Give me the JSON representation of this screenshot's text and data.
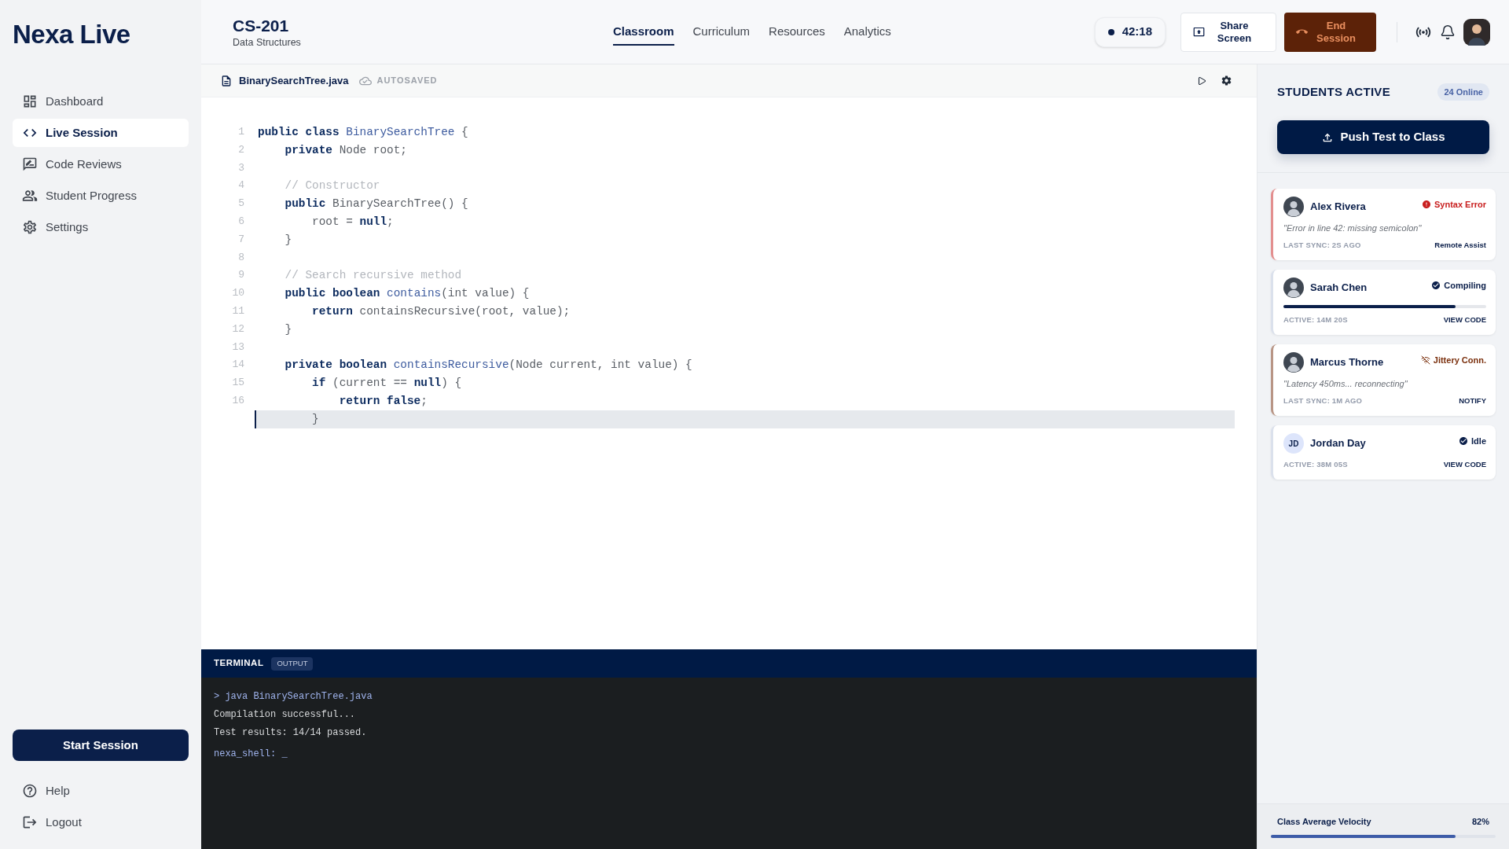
{
  "sidebar": {
    "logo": "Nexa Live",
    "nav": [
      {
        "label": "Dashboard",
        "selected": false
      },
      {
        "label": "Live Session",
        "selected": true
      },
      {
        "label": "Code Reviews",
        "selected": false
      },
      {
        "label": "Student Progress",
        "selected": false
      },
      {
        "label": "Settings",
        "selected": false
      }
    ],
    "start_button": "Start Session",
    "footer_links": [
      "Help",
      "Logout"
    ]
  },
  "header": {
    "course_code": "CS-201",
    "course_name": "Data Structures",
    "tabs": [
      {
        "label": "Classroom",
        "selected": true
      },
      {
        "label": "Curriculum",
        "selected": false
      },
      {
        "label": "Resources",
        "selected": false
      },
      {
        "label": "Analytics",
        "selected": false
      }
    ],
    "timer": "42:18",
    "share_button": "Share Screen",
    "end_button": "End Session"
  },
  "editor": {
    "file_name": "BinarySearchTree.java",
    "save_status": "AUTOSAVED",
    "lines": [
      {
        "number": "1",
        "current": false,
        "tokens": [
          {
            "kind": "kw",
            "text": "public class "
          },
          {
            "kind": "fn",
            "text": "BinarySearchTree"
          },
          {
            "kind": "tx",
            "text": " {"
          }
        ]
      },
      {
        "number": "2",
        "current": false,
        "tokens": [
          {
            "kind": "kw",
            "text": "    private "
          },
          {
            "kind": "tx",
            "text": "Node root;"
          }
        ]
      },
      {
        "number": "3",
        "current": false
      },
      {
        "number": "4",
        "current": false,
        "tokens": [
          {
            "kind": "cm",
            "text": "    // Constructor"
          }
        ]
      },
      {
        "number": "5",
        "current": false,
        "tokens": [
          {
            "kind": "kw",
            "text": "    public "
          },
          {
            "kind": "tx",
            "text": "BinarySearchTree() {"
          }
        ]
      },
      {
        "number": "6",
        "current": false,
        "tokens": [
          {
            "kind": "tx",
            "text": "        root = "
          },
          {
            "kind": "kw",
            "text": "null"
          },
          {
            "kind": "tx",
            "text": ";"
          }
        ]
      },
      {
        "number": "7",
        "current": false,
        "tokens": [
          {
            "kind": "tx",
            "text": "    }"
          }
        ]
      },
      {
        "number": "8",
        "current": false
      },
      {
        "number": "9",
        "current": false,
        "tokens": [
          {
            "kind": "cm",
            "text": "    // Search recursive method"
          }
        ]
      },
      {
        "number": "10",
        "current": false,
        "tokens": [
          {
            "kind": "kw",
            "text": "    public boolean "
          },
          {
            "kind": "fn",
            "text": "contains"
          },
          {
            "kind": "tx",
            "text": "(int value) {"
          }
        ]
      },
      {
        "number": "11",
        "current": false,
        "tokens": [
          {
            "kind": "kw",
            "text": "        return "
          },
          {
            "kind": "tx",
            "text": "containsRecursive(root, value);"
          }
        ]
      },
      {
        "number": "12",
        "current": false,
        "tokens": [
          {
            "kind": "tx",
            "text": "    }"
          }
        ]
      },
      {
        "number": "13",
        "current": false
      },
      {
        "number": "14",
        "current": false,
        "tokens": [
          {
            "kind": "kw",
            "text": "    private boolean "
          },
          {
            "kind": "fn",
            "text": "containsRecursive"
          },
          {
            "kind": "tx",
            "text": "(Node current, int value) {"
          }
        ]
      },
      {
        "number": "15",
        "current": false,
        "tokens": [
          {
            "kind": "kw",
            "text": "        if "
          },
          {
            "kind": "tx",
            "text": "(current == "
          },
          {
            "kind": "kw",
            "text": "null"
          },
          {
            "kind": "tx",
            "text": ") {"
          }
        ]
      },
      {
        "number": "16",
        "current": false,
        "tokens": [
          {
            "kind": "kw",
            "text": "            return false"
          },
          {
            "kind": "tx",
            "text": ";"
          }
        ]
      },
      {
        "current": true,
        "tokens": [
          {
            "kind": "tx",
            "text": "        }"
          }
        ]
      }
    ]
  },
  "terminal": {
    "tabs": [
      {
        "label": "TERMINAL",
        "selected": true
      },
      {
        "label": "OUTPUT",
        "selected": false
      }
    ],
    "lines": [
      {
        "kind": "command",
        "text": "> java BinarySearchTree.java"
      },
      {
        "kind": "output",
        "text": "Compilation successful..."
      },
      {
        "kind": "output",
        "text": "Test results: 14/14 passed."
      },
      {
        "kind": "prompt",
        "text": "nexa_shell: _"
      }
    ]
  },
  "students_panel": {
    "title": "STUDENTS ACTIVE",
    "online": "24 Online",
    "push_button": "Push Test to Class",
    "students": [
      {
        "kind": "error",
        "name": "Alex Rivera",
        "status": "Syntax Error",
        "note": "\"Error in line 42: missing semicolon\"",
        "activity": "LAST SYNC: 2S AGO",
        "action": "Remote Assist"
      },
      {
        "kind": "ok",
        "name": "Sarah Chen",
        "status": "Compiling",
        "level": 0.85,
        "activity": "ACTIVE: 14M 20S",
        "action": "VIEW CODE"
      },
      {
        "kind": "warning",
        "name": "Marcus Thorne",
        "status": "Jittery Conn.",
        "note": "\"Latency 450ms... reconnecting\"",
        "activity": "LAST SYNC: 1M AGO",
        "action": "NOTIFY"
      },
      {
        "kind": "ok",
        "name": "Jordan Day",
        "initials": "JD",
        "status": "Idle",
        "activity": "ACTIVE: 38M 05S",
        "action": "VIEW CODE"
      }
    ]
  },
  "velocity": {
    "label": "Class Average Velocity",
    "reading": "82%",
    "level": 0.82
  }
}
